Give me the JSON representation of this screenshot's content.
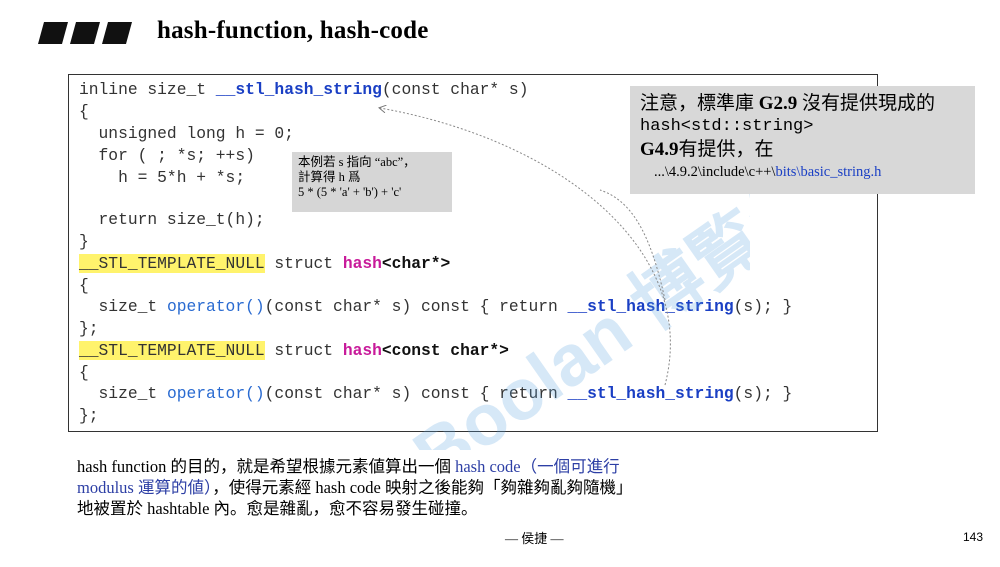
{
  "header": {
    "title": "hash-function, hash-code"
  },
  "code": {
    "l1_a": "inline size_t ",
    "l1_fn": "__stl_hash_string",
    "l1_b": "(const char* s)",
    "l2": "{",
    "l3": "  unsigned long h = 0;",
    "l4": "  for ( ; *s; ++s)",
    "l5": "    h = 5*h + *s;",
    "l6": "  return size_t(h);",
    "l7": "}",
    "l8_macro": "__STL_TEMPLATE_NULL",
    "l8_b": " struct ",
    "l8_hash": "hash",
    "l8_t": "<char*>",
    "l9": "{",
    "l10_a": "  size_t ",
    "l10_op": "operator()",
    "l10_b": "(const char* s) const { return ",
    "l10_fn": "__stl_hash_string",
    "l10_c": "(s); }",
    "l11": "};",
    "l12_macro": "__STL_TEMPLATE_NULL",
    "l12_b": " struct ",
    "l12_hash": "hash",
    "l12_t": "<const char*>",
    "l13": "{",
    "l14_a": "  size_t ",
    "l14_op": "operator()",
    "l14_b": "(const char* s) const { return ",
    "l14_fn": "__stl_hash_string",
    "l14_c": "(s); }",
    "l15": "};"
  },
  "inline_note": {
    "line1": "本例若 s 指向 “abc”，",
    "line2": "計算得 h 爲",
    "line3": "5 * (5 * 'a' + 'b') + 'c'"
  },
  "callout": {
    "line1_a": "注意，標準庫 ",
    "line1_b": "G2.9",
    "line1_c": " 沒有提供現成的",
    "line2": "hash<std::string>",
    "line3_a": "G4.9",
    "line3_b": "有提供，在",
    "line4_a": "...\\4.9.2\\include\\c++\\",
    "line4_b": "bits\\basic_string.h"
  },
  "description": {
    "p1": "hash function 的目的，就是希望根據元素値算出一個 ",
    "p1_blue": "hash code（一個可進行",
    "p2_blue": "modulus 運算的値）",
    "p2": "，使得元素經 hash code 映射之後能夠「夠雜夠亂夠隨機」",
    "p3": "地被置於 hashtable 內。愈是雜亂，愈不容易發生碰撞。"
  },
  "footer": {
    "author": "— 侯捷 —",
    "page": "143"
  },
  "watermark": {
    "text": "Boolan 博覧網"
  },
  "colors": {
    "highlight": "#fff36c",
    "keyword_blue": "#1a3fc4",
    "magenta": "#c81a9a",
    "callout_bg": "#d8d8d8"
  }
}
